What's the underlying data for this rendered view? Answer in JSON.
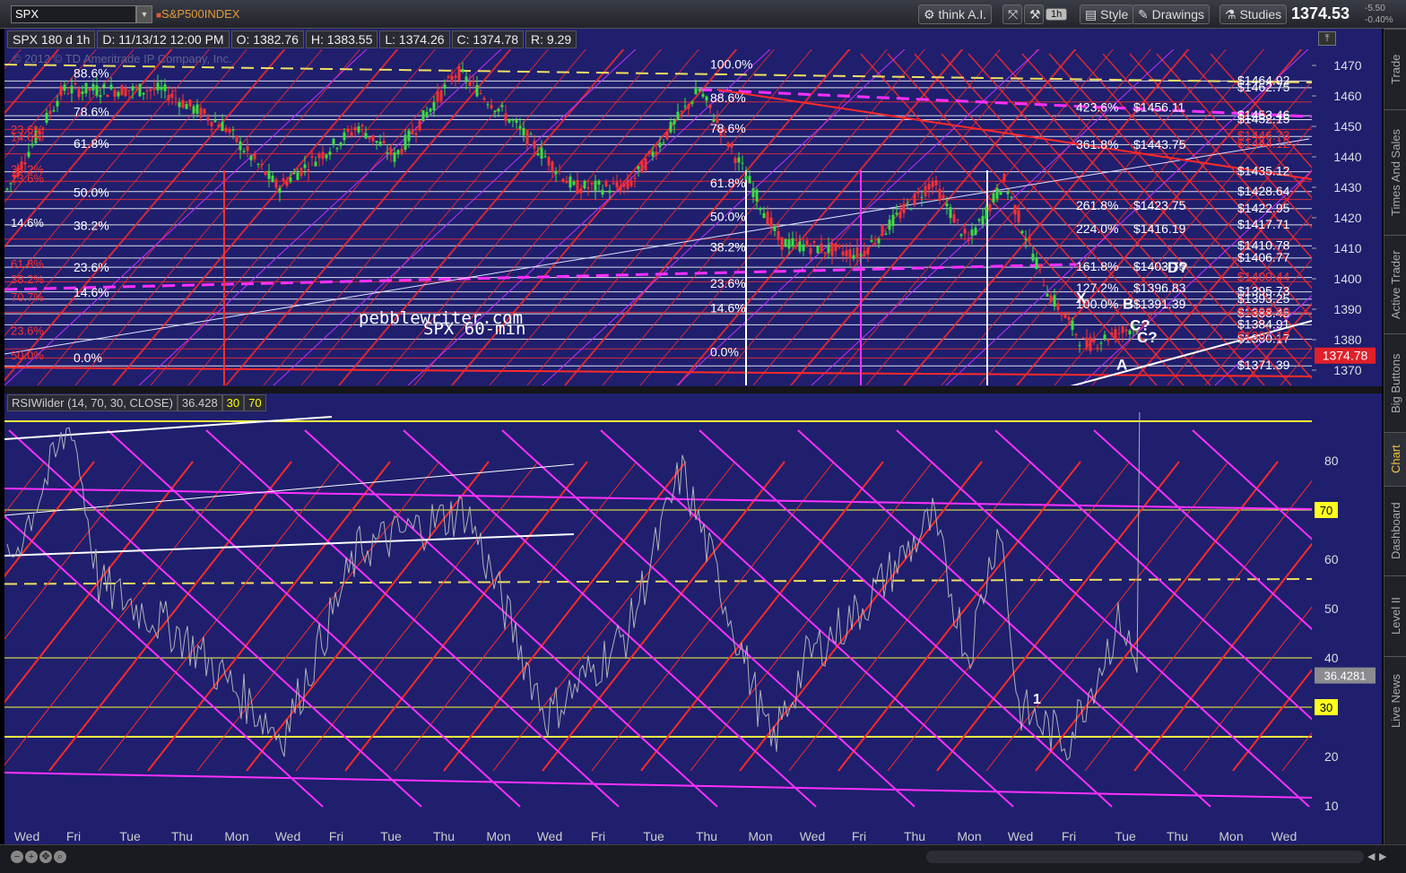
{
  "toolbar": {
    "symbol": "SPX",
    "description": "S&P500INDEX",
    "think_ai": "think A.I.",
    "interval": "1h",
    "style": "Style",
    "drawings": "Drawings",
    "studies": "Studies",
    "last": "1374.53",
    "change": "-5.50",
    "change_pct": "-0.40%"
  },
  "header": {
    "title": "SPX 180 d 1h",
    "date": "D: 11/13/12 12:00 PM",
    "open": "O: 1382.76",
    "high": "H: 1383.55",
    "low": "L: 1374.26",
    "close": "C: 1374.78",
    "range": "R: 9.29"
  },
  "copyright": "© 2012 © TD Ameritrade IP Company, Inc.",
  "watermark": [
    "pebblewriter.com",
    "SPX 60-min"
  ],
  "price_axis": {
    "labels": [
      "1470",
      "1460",
      "1450",
      "1440",
      "1430",
      "1420",
      "1410",
      "1400",
      "1390",
      "1380",
      "1370"
    ],
    "current_label": "1374.78",
    "current_color": "#e0202a"
  },
  "fib_left": [
    "88.6%",
    "78.6%",
    "61.8%",
    "50.0%",
    "38.2%",
    "23.6%",
    "14.6%",
    "0.0%"
  ],
  "fib_mid": [
    "100.0%",
    "88.6%",
    "78.6%",
    "61.8%",
    "50.0%",
    "38.2%",
    "23.6%",
    "14.6%",
    "0.0%"
  ],
  "fib_red_left": [
    "23.6%",
    "14.6%",
    "38.2%",
    "23.6%",
    "61.8%",
    "38.2%",
    "70.7%",
    "23.6%",
    "50.0%"
  ],
  "fib_ext": [
    {
      "pct": "423.6%",
      "val": "$1456.11"
    },
    {
      "pct": "361.8%",
      "val": "$1443.75"
    },
    {
      "pct": "261.8%",
      "val": "$1423.75"
    },
    {
      "pct": "224.0%",
      "val": "$1416.19"
    },
    {
      "pct": "161.8%",
      "val": "$1403.75"
    },
    {
      "pct": "127.2%",
      "val": "$1396.83"
    },
    {
      "pct": "100.0%",
      "val": "$1391.39"
    }
  ],
  "price_levels": [
    "$1464.92",
    "$1462.75",
    "$1453.46",
    "$1452.15",
    "$1435.12",
    "$1428.64",
    "$1422.95",
    "$1417.71",
    "$1410.78",
    "$1406.77",
    "$1395.73",
    "$1393.25",
    "$1388.45",
    "$1384.91",
    "$1380.17",
    "$1371.39"
  ],
  "red_levels": [
    "$1446.73",
    "$1444.12",
    "$1400.44",
    "$1388.90",
    "$1381.12"
  ],
  "pattern_labels": [
    "X",
    "A",
    "B",
    "C?",
    "D?",
    "C?"
  ],
  "rsi": {
    "header": "RSIWilder (14, 70, 30, CLOSE)",
    "value": "36.428",
    "ob": "30",
    "os": "70",
    "axis": [
      "80",
      "60",
      "50",
      "40",
      "20",
      "10"
    ],
    "ob_label": "70",
    "os_label": "30",
    "current": "36.4281",
    "wave_label": "1"
  },
  "x_axis": [
    "Wed",
    "Fri",
    "Tue",
    "Thu",
    "Mon",
    "Wed",
    "Fri",
    "Tue",
    "Thu",
    "Mon",
    "Wed",
    "Fri",
    "Tue",
    "Thu",
    "Mon",
    "Wed",
    "Fri",
    "Thu",
    "Mon",
    "Wed",
    "Fri",
    "Tue",
    "Thu",
    "Mon",
    "Wed"
  ],
  "sidebar": [
    "Trade",
    "Times And Sales",
    "Active Trader",
    "Big Buttons",
    "Chart",
    "Dashboard",
    "Level II",
    "Live News"
  ],
  "colors": {
    "background": "#1f1f6e",
    "fib_white": "#ffffff",
    "channel_red": "#ff2a2a",
    "channel_magenta": "#ff30ff",
    "dashed_yellow": "#f0e060",
    "rsi_line": "#b0b0b8"
  }
}
